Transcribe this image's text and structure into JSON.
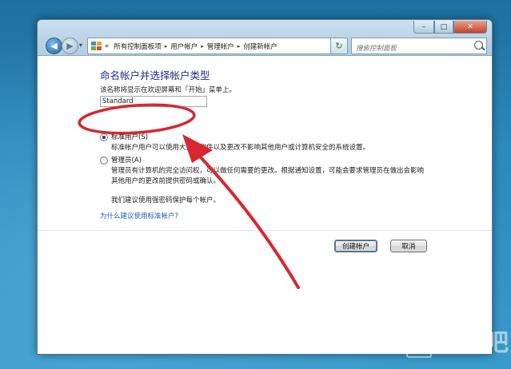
{
  "window": {
    "caption_min": "–",
    "caption_max": "□",
    "caption_close": "✕"
  },
  "toolbar": {
    "back_glyph": "◀",
    "forward_glyph": "▶",
    "history_glyph": "▾",
    "refresh_glyph": "↻"
  },
  "address": {
    "prefix": "«",
    "crumbs": [
      "所有控制面板项",
      "用户帐户",
      "管理帐户",
      "创建新帐户"
    ],
    "sep": "▸",
    "dropdown": "▾"
  },
  "search": {
    "placeholder": "搜索控制面板"
  },
  "page": {
    "heading": "命名帐户并选择帐户类型",
    "description": "该名称将显示在欢迎屏幕和「开始」菜单上。",
    "name_value": "Standard",
    "standard": {
      "label": "标准用户(S)",
      "description": "标准帐户用户可以使用大多数软件以及更改不影响其他用户或计算机安全的系统设置。",
      "selected": true
    },
    "admin": {
      "label": "管理员(A)",
      "description_line1": "管理员有计算机的完全访问权，可以做任何需要的更改。根据通知设置，可能会要求管理员在做出会影响",
      "description_line2": "其他用户的更改前提供密码或确认。",
      "selected": false
    },
    "recommend": "我们建议使用强密码保护每个帐户。",
    "why_link": "为什么建议使用标准帐户?"
  },
  "buttons": {
    "create": "创建帐户",
    "cancel": "取消"
  },
  "annotation": {
    "color": "#d8272f"
  },
  "watermark": {
    "text": "下载吧"
  }
}
